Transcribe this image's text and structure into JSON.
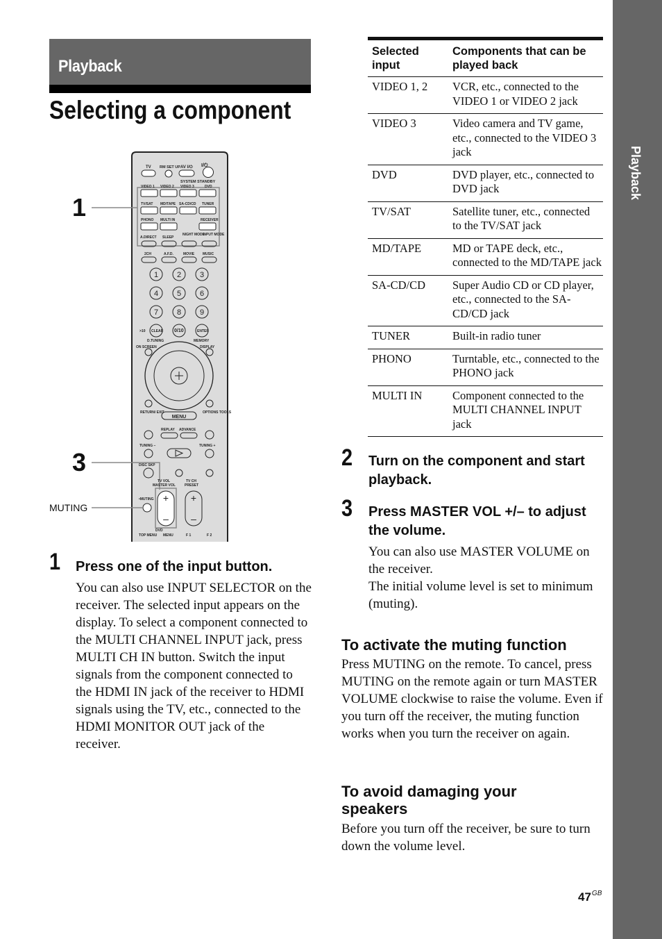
{
  "section_tab": "Playback",
  "side_tab": "Playback",
  "page_title": "Selecting a component",
  "figure": {
    "callouts": [
      "1",
      "3"
    ],
    "muting_label": "MUTING",
    "remote_labels": {
      "row1": [
        "TV",
        "RM SET UP",
        "AV I/⏻",
        "I/⏻"
      ],
      "system_standby": "SYSTEM STANDBY",
      "inputs_row1": [
        "VIDEO 1",
        "VIDEO 2",
        "VIDEO 3",
        "DVD"
      ],
      "inputs_row2": [
        "TV/SAT",
        "MD/TAPE",
        "SA-CD/CD",
        "TUNER"
      ],
      "inputs_row3": [
        "PHONO",
        "MULTI IN",
        "RECEIVER"
      ],
      "modes_row1": [
        "A.DIRECT",
        "SLEEP",
        "NIGHT MODE",
        "INPUT MODE"
      ],
      "modes_row2": [
        "2CH",
        "A.F.D.",
        "MOVIE",
        "MUSIC"
      ],
      "digits": [
        "1",
        "2",
        "3",
        "4",
        "5",
        "6",
        "7",
        "8",
        "9"
      ],
      "clear": "CLEAR",
      "zero": "0/10",
      "enter": "ENTER",
      "gt10": ">10",
      "d_tuning": "D.TUNING",
      "memory": "MEMORY",
      "on_screen": "ON SCREEN",
      "display": "DISPLAY",
      "return_exit": "RETURN/ EXIT",
      "menu": "MENU",
      "options_tools": "OPTIONS TOOLS",
      "replay": "REPLAY",
      "advance": "ADVANCE",
      "tuning_minus": "TUNING –",
      "tuning_plus": "TUNING +",
      "disc_skip": "DISC SKP",
      "tv_vol": "TV VOL",
      "master_vol": "MASTER VOL",
      "tv_ch": "TV CH",
      "preset": "PRESET",
      "muting_small": "•MUTING",
      "dvd": "DVD",
      "top_menu": "TOP MENU",
      "dvd_menu": "MENU",
      "f1": "F 1",
      "f2": "F 2"
    }
  },
  "steps": [
    {
      "number": "1",
      "title": "Press one of the input button.",
      "body": "You can also use INPUT SELECTOR on the receiver. The selected input appears on the display. To select a component connected to the MULTI CHANNEL INPUT jack, press MULTI CH IN button. Switch the input signals from the component connected to the HDMI IN jack of the receiver to HDMI signals using the TV, etc., connected to the HDMI MONITOR OUT jack of the receiver."
    },
    {
      "number": "2",
      "title": "Turn on the component and start playback."
    },
    {
      "number": "3",
      "title": "Press MASTER VOL +/– to adjust the volume.",
      "body_lines": [
        "You can also use MASTER VOLUME on the receiver.",
        "The initial volume level is set to minimum (muting)."
      ]
    }
  ],
  "table": {
    "headers": [
      "Selected input",
      "Components that can be played back"
    ],
    "rows": [
      [
        "VIDEO 1, 2",
        "VCR, etc., connected to the VIDEO 1 or VIDEO 2 jack"
      ],
      [
        "VIDEO 3",
        "Video camera and TV game, etc., connected to the VIDEO 3 jack"
      ],
      [
        "DVD",
        "DVD player, etc., connected to DVD jack"
      ],
      [
        "TV/SAT",
        "Satellite tuner, etc., connected to the TV/SAT jack"
      ],
      [
        "MD/TAPE",
        "MD or TAPE deck, etc., connected to the MD/TAPE jack"
      ],
      [
        "SA-CD/CD",
        "Super Audio CD or CD player, etc., connected to the SA-CD/CD jack"
      ],
      [
        "TUNER",
        "Built-in radio tuner"
      ],
      [
        "PHONO",
        "Turntable, etc., connected to the PHONO jack"
      ],
      [
        "MULTI IN",
        "Component connected to the MULTI CHANNEL INPUT jack"
      ]
    ]
  },
  "muting_section": {
    "heading": "To activate the muting function",
    "body": "Press MUTING on the remote. To cancel, press MUTING on the remote again or turn MASTER VOLUME clockwise to raise the volume. Even if you turn off the receiver, the muting function works when you turn the receiver on again."
  },
  "speakers_section": {
    "heading": "To avoid damaging your speakers",
    "body": "Before you turn off the receiver, be sure to turn down the volume level."
  },
  "page_number": "47",
  "page_suffix": "GB"
}
